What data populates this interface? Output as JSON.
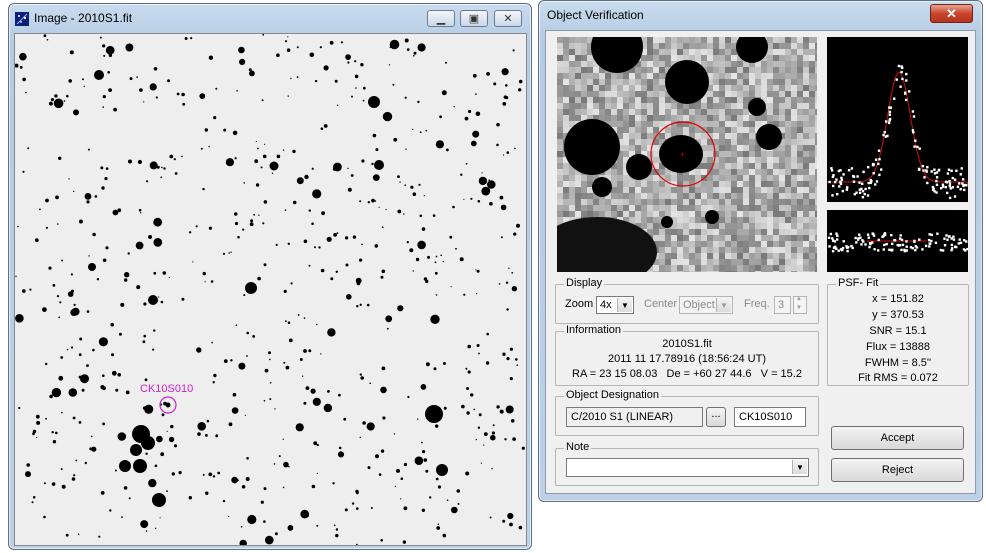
{
  "image_window": {
    "title": "Image - 2010S1.fit",
    "object_label": "CK10S010",
    "colors": {
      "marker": "#d01fd0",
      "stars": "#000000",
      "background": "#eeeeee"
    }
  },
  "dialog": {
    "title": "Object Verification",
    "display": {
      "group_title": "Display",
      "zoom_label": "Zoom",
      "zoom_value": "4x",
      "center_label": "Center",
      "center_value": "Object",
      "freq_label": "Freq.",
      "freq_value": "3"
    },
    "information": {
      "group_title": "Information",
      "file": "2010S1.fit",
      "datetime": "2011 11 17.78916 (18:56:24 UT)",
      "coords": "RA = 23 15 08.03   De = +60 27 44.6   V = 15.2"
    },
    "designation": {
      "group_title": "Object Designation",
      "name": "C/2010 S1 (LINEAR)",
      "browse_label": "...",
      "code": "CK10S010"
    },
    "note": {
      "group_title": "Note",
      "value": ""
    },
    "psf": {
      "group_title": "PSF- Fit",
      "x": "x = 151.82",
      "y": "y = 370.53",
      "snr": "SNR = 15.1",
      "flux": "Flux = 13888",
      "fwhm": "FWHM = 8.5''",
      "fit_rms": "Fit RMS = 0.072"
    },
    "buttons": {
      "accept": "Accept",
      "reject": "Reject"
    },
    "colors": {
      "fit_curve": "#d01010",
      "target_circle": "#e00000"
    }
  }
}
